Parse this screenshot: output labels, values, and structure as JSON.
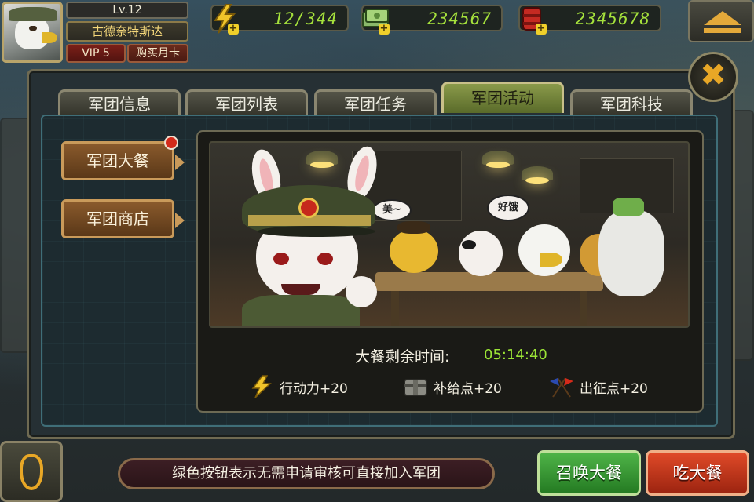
{
  "player": {
    "level": "Lv.12",
    "name": "古德奈特斯达",
    "vip": "VIP 5",
    "buy_month_card": "购买月卡"
  },
  "resources": {
    "energy": "12/344",
    "money": "234567",
    "gems": "2345678"
  },
  "tabs": [
    {
      "label": "军团信息"
    },
    {
      "label": "军团列表"
    },
    {
      "label": "军团任务"
    },
    {
      "label": "军团活动"
    },
    {
      "label": "军团科技"
    }
  ],
  "active_tab": "军团活动",
  "side_menu": [
    {
      "label": "军团大餐"
    },
    {
      "label": "军团商店"
    }
  ],
  "scene": {
    "bubble_left": "美~",
    "bubble_right": "好饿"
  },
  "feast": {
    "timer_label": "大餐剩余时间:",
    "timer_value": "05:14:40",
    "rewards": [
      {
        "icon": "lightning-icon",
        "text": "行动力+20"
      },
      {
        "icon": "supply-crate-icon",
        "text": "补给点+20"
      },
      {
        "icon": "crossed-flags-icon",
        "text": "出征点+20"
      }
    ]
  },
  "bottom": {
    "notice": "绿色按钮表示无需申请审核可直接加入军团",
    "summon_button": "召唤大餐",
    "eat_button": "吃大餐"
  },
  "colors": {
    "timer": "#9be436",
    "resource_value": "#a6e23c",
    "green_button": "#2f9a2a",
    "red_button": "#c33a1c",
    "notification_dot": "#d42a1a"
  }
}
